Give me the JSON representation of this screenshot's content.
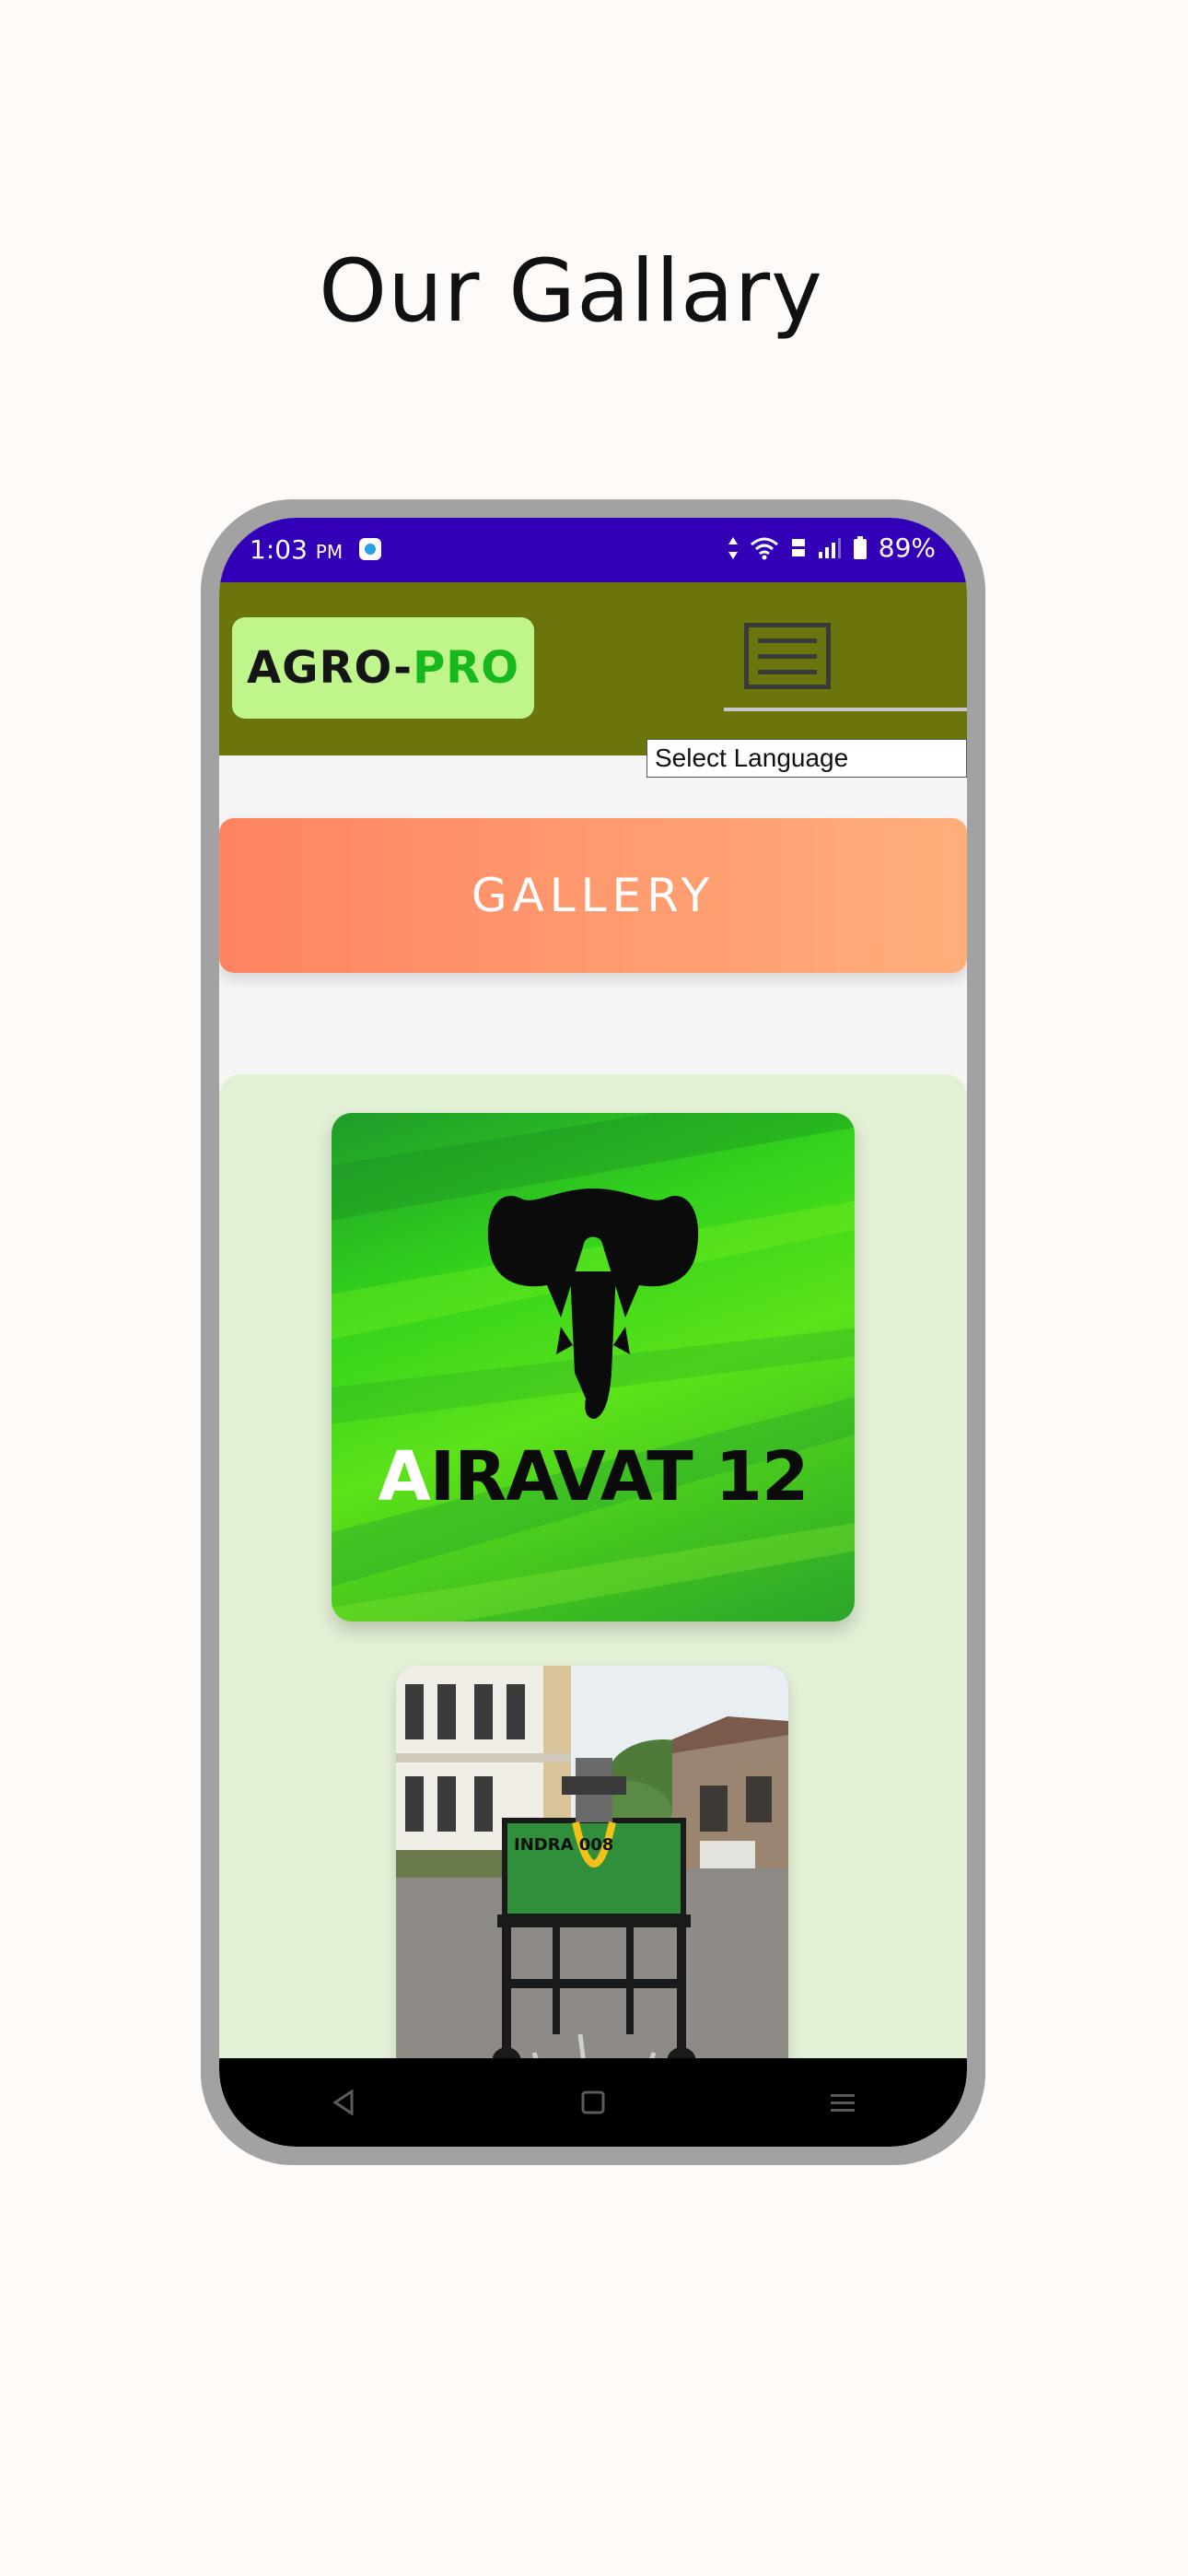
{
  "page": {
    "title": "Our Gallary"
  },
  "status_bar": {
    "time": "1:03",
    "ampm": "PM",
    "battery": "89%"
  },
  "app": {
    "logo_part1": "AGRO-",
    "logo_part2": "PRO",
    "language_select": "Select Language",
    "banner_label": "GALLERY"
  },
  "gallery": {
    "card1_text_first": "A",
    "card1_text_rest": "IRAVAT 12",
    "card2_sign": "INDRA 008"
  },
  "colors": {
    "status_bar": "#3200b6",
    "header": "#6c740c",
    "logo_bg": "#c0f58c",
    "logo_accent": "#17b81c",
    "banner_start": "#ff8462",
    "banner_end": "#ffae7a",
    "gallery_panel": "#e2f0d6"
  },
  "icons": {
    "menu": "hamburger-menu-icon",
    "wifi": "wifi-icon",
    "signal": "signal-icon",
    "battery": "battery-icon",
    "back": "back-icon",
    "home": "home-icon",
    "recents": "recents-icon"
  }
}
